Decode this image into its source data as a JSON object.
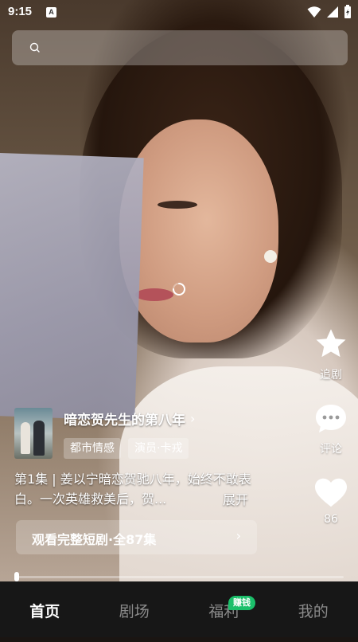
{
  "status_bar": {
    "time": "9:15",
    "notification_icon": "A"
  },
  "search": {
    "placeholder": ""
  },
  "side_actions": {
    "follow_label": "追剧",
    "comment_label": "评论",
    "like_count": "86"
  },
  "drama": {
    "title": "暗恋贺先生的第八年",
    "tags": [
      "都市情感",
      "演员·卡戎"
    ],
    "description": "第1集 | 姜以宁暗恋贺驰八年，始终不敢表白。一次英雄救美后，贺...",
    "expand_label": "展开",
    "watch_full_label": "观看完整短剧·全87集"
  },
  "progress": {
    "fraction": 0.01
  },
  "bottom_nav": {
    "items": [
      "首页",
      "剧场",
      "福利",
      "我的"
    ],
    "active": "首页",
    "badge": "赚钱"
  },
  "colors": {
    "badge_green": "#1bbf6a",
    "nav_bg": "#171717"
  }
}
